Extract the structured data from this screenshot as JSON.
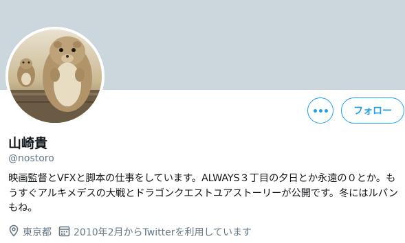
{
  "profile": {
    "name": "山崎貴",
    "handle": "@nostoro",
    "bio": "映画監督とVFXと脚本の仕事をしています。ALWAYS３丁目の夕日とか永遠の０とか。もうすぐアルキメデスの大戦とドラゴンクエストユアストーリーが公開です。冬にはルパンもね。",
    "location": "東京都",
    "joined": "2010年2月からTwitterを利用しています"
  },
  "actions": {
    "follow_label": "フォロー",
    "more_icon": "more-horizontal-icon"
  },
  "icons": {
    "location": "location-pin-icon",
    "calendar": "calendar-icon"
  },
  "colors": {
    "accent": "#1da1f2",
    "banner": "#ccd6dd",
    "secondary_text": "#657786",
    "primary_text": "#14171a"
  }
}
